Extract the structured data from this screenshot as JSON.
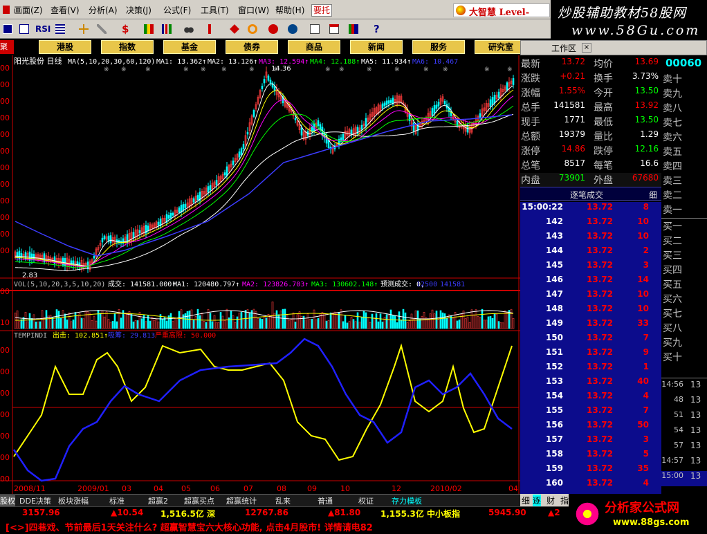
{
  "menu": {
    "items": [
      "画面(Z)",
      "查看(V)",
      "分析(A)",
      "决策(J)",
      "公式(F)",
      "工具(T)",
      "窗口(W)",
      "帮助(H)"
    ],
    "top_button": "要托",
    "brand": "大智慧 Level-"
  },
  "watermark_top": {
    "line1": "炒股辅助教材58股网",
    "line2": "www.58Gu.com"
  },
  "toolbar": {
    "rsi_label": "RSI",
    "icons": [
      "window-icon",
      "chart-icon",
      "rsi-icon",
      "grid-icon",
      "crosshair-icon",
      "ruler-icon",
      "dollar-icon",
      "flag-icon",
      "bars-icon",
      "binoculars-icon",
      "arrow-icon",
      "diamond-icon",
      "ring-icon",
      "ring2-icon",
      "page-icon",
      "list-icon",
      "books-icon",
      "help-icon"
    ]
  },
  "nav": {
    "left_label": "聚票",
    "buttons": [
      "港股",
      "指数",
      "基金",
      "债券",
      "商品",
      "新闻",
      "服务",
      "研究室"
    ],
    "workspace": "工作区",
    "workspace_close": "×"
  },
  "chart": {
    "title": "阳光股份 日线",
    "ma_line": [
      {
        "text": "MA(5,10,20,30,60,120)",
        "color": "#ffffff"
      },
      {
        "text": "MA1: 13.362↑",
        "color": "#ffffff"
      },
      {
        "text": "MA2: 13.126↑",
        "color": "#ffffff"
      },
      {
        "text": "MA3: 12.594↑",
        "color": "#ff00ff"
      },
      {
        "text": "MA4: 12.188↑",
        "color": "#00ff00"
      },
      {
        "text": "MA5: 11.934↑",
        "color": "#ffffff"
      },
      {
        "text": "MA6: 10.467",
        "color": "#3c3cff"
      }
    ],
    "high_label": "14.36",
    "low_label": "2.83",
    "vol_line": [
      {
        "text": "VOL(5,10,20,3,5,10,20)",
        "color": "#c0c0c0"
      },
      {
        "text": "成交: 141581.000↑",
        "color": "#ffffff"
      },
      {
        "text": "MA1: 120480.797↑",
        "color": "#ffffff"
      },
      {
        "text": "MA2: 123826.703↑",
        "color": "#ff00ff"
      },
      {
        "text": "MA3: 130602.148↑",
        "color": "#00ff00"
      },
      {
        "text": "预测成交: 0,",
        "color": "#ffffff"
      },
      {
        "text": "12500",
        "color": "#3c3cff"
      },
      {
        "text": "141581",
        "color": "#3c3cff"
      }
    ],
    "ind_line": [
      {
        "text": "TEMPINDI",
        "color": "#c0c0c0"
      },
      {
        "text": "出击: 102.851↑",
        "color": "#ffff00"
      },
      {
        "text": "吸筹: 29.813",
        "color": "#3c3cff"
      },
      {
        "text": "严重高限: 50.000",
        "color": "#ff0000"
      }
    ],
    "x_labels": [
      "2008/11",
      "2009/01",
      "03",
      "04",
      "05",
      "06",
      "07",
      "08",
      "09",
      "10",
      "12",
      "2010/02",
      "04"
    ],
    "y_labels_price": [
      "00",
      "00",
      "00",
      "00",
      "00",
      "00",
      "00",
      "00",
      "00",
      "00",
      "00",
      "00"
    ],
    "y_labels_ind": [
      "00",
      "00",
      "00",
      "00",
      "00",
      "00",
      "00"
    ],
    "y_labels_vol": [
      "00",
      "10"
    ]
  },
  "quote": {
    "rows": [
      {
        "l1": "最新",
        "v1": "13.72",
        "l2": "均价",
        "v2": "13.69",
        "c1": "#ff0000",
        "c2": "#ff0000"
      },
      {
        "l1": "涨跌",
        "v1": "+0.21",
        "l2": "换手",
        "v2": "3.73%",
        "c1": "#ff0000",
        "c2": "#ffffff"
      },
      {
        "l1": "涨幅",
        "v1": "1.55%",
        "l2": "今开",
        "v2": "13.50",
        "c1": "#ff0000",
        "c2": "#00ff00"
      },
      {
        "l1": "总手",
        "v1": "141581",
        "l2": "最高",
        "v2": "13.92",
        "c1": "#ffffff",
        "c2": "#ff0000"
      },
      {
        "l1": "现手",
        "v1": "1771",
        "l2": "最低",
        "v2": "13.50",
        "c1": "#ffffff",
        "c2": "#00ff00"
      },
      {
        "l1": "总额",
        "v1": "19379",
        "l2": "量比",
        "v2": "1.29",
        "c1": "#ffffff",
        "c2": "#ffffff"
      },
      {
        "l1": "涨停",
        "v1": "14.86",
        "l2": "跌停",
        "v2": "12.16",
        "c1": "#ff0000",
        "c2": "#00ff00"
      },
      {
        "l1": "总笔",
        "v1": "8517",
        "l2": "每笔",
        "v2": "16.6",
        "c1": "#ffffff",
        "c2": "#ffffff"
      },
      {
        "l1": "内盘",
        "v1": "73901",
        "l2": "外盘",
        "v2": "67680",
        "c1": "#00ff00",
        "c2": "#ff0000"
      }
    ],
    "code": "00060"
  },
  "orderbook": {
    "sell": [
      "卖十",
      "卖九",
      "卖八",
      "卖七",
      "卖六",
      "卖五",
      "卖四",
      "卖三",
      "卖二",
      "卖一"
    ],
    "buy": [
      "买一",
      "买二",
      "买三",
      "买四",
      "买五",
      "买六",
      "买七",
      "买八",
      "买九",
      "买十"
    ]
  },
  "tape": {
    "header": "逐笔成交",
    "header_right": "细",
    "rows": [
      {
        "t": "15:00:22",
        "p": "13.72",
        "v": "8"
      },
      {
        "t": "142",
        "p": "13.72",
        "v": "10"
      },
      {
        "t": "143",
        "p": "13.72",
        "v": "10"
      },
      {
        "t": "144",
        "p": "13.72",
        "v": "2"
      },
      {
        "t": "145",
        "p": "13.72",
        "v": "3"
      },
      {
        "t": "146",
        "p": "13.72",
        "v": "14"
      },
      {
        "t": "147",
        "p": "13.72",
        "v": "10"
      },
      {
        "t": "148",
        "p": "13.72",
        "v": "10"
      },
      {
        "t": "149",
        "p": "13.72",
        "v": "33"
      },
      {
        "t": "150",
        "p": "13.72",
        "v": "7"
      },
      {
        "t": "151",
        "p": "13.72",
        "v": "9"
      },
      {
        "t": "152",
        "p": "13.72",
        "v": "1"
      },
      {
        "t": "153",
        "p": "13.72",
        "v": "40"
      },
      {
        "t": "154",
        "p": "13.72",
        "v": "4"
      },
      {
        "t": "155",
        "p": "13.72",
        "v": "7"
      },
      {
        "t": "156",
        "p": "13.72",
        "v": "50"
      },
      {
        "t": "157",
        "p": "13.72",
        "v": "3"
      },
      {
        "t": "158",
        "p": "13.72",
        "v": "5"
      },
      {
        "t": "159",
        "p": "13.72",
        "v": "35"
      },
      {
        "t": "160",
        "p": "13.72",
        "v": "4"
      }
    ]
  },
  "mini": {
    "rows": [
      {
        "t": "14:56",
        "p": "13"
      },
      {
        "t": "48",
        "p": "13"
      },
      {
        "t": "51",
        "p": "13"
      },
      {
        "t": "54",
        "p": "13"
      },
      {
        "t": "57",
        "p": "13"
      },
      {
        "t": "14:57",
        "p": "13"
      },
      {
        "t": "15:00",
        "p": "13"
      }
    ]
  },
  "bottom_tabs": [
    "股权",
    "DDE决策",
    "板块涨幅",
    "标准",
    "超赢2",
    "超赢买点",
    "超赢统计",
    "乱来",
    "普通",
    "权证",
    "存力模板"
  ],
  "bottom_tabs_right": [
    "细",
    "逐",
    "财",
    "指"
  ],
  "ticker": [
    {
      "text": "3157.96",
      "color": "#ff0000"
    },
    {
      "text": "▲10.54",
      "color": "#ff0000"
    },
    {
      "text": "1,516.5亿 深",
      "color": "#ffff00"
    },
    {
      "text": "12767.86",
      "color": "#ff0000"
    },
    {
      "text": "▲81.80",
      "color": "#ff0000"
    },
    {
      "text": "1,155.3亿 中小板指",
      "color": "#ffff00"
    },
    {
      "text": "5945.90",
      "color": "#ff0000"
    },
    {
      "text": "▲2",
      "color": "#ff0000"
    }
  ],
  "scroll_text": "[<>]四巷戏、节前最后1天关注什么? 超赢智慧宝六大核心功能, 点击4月股市! 详情请电82",
  "watermark_bottom": {
    "name": "分析家公式网",
    "url": "www.88gs.com"
  }
}
